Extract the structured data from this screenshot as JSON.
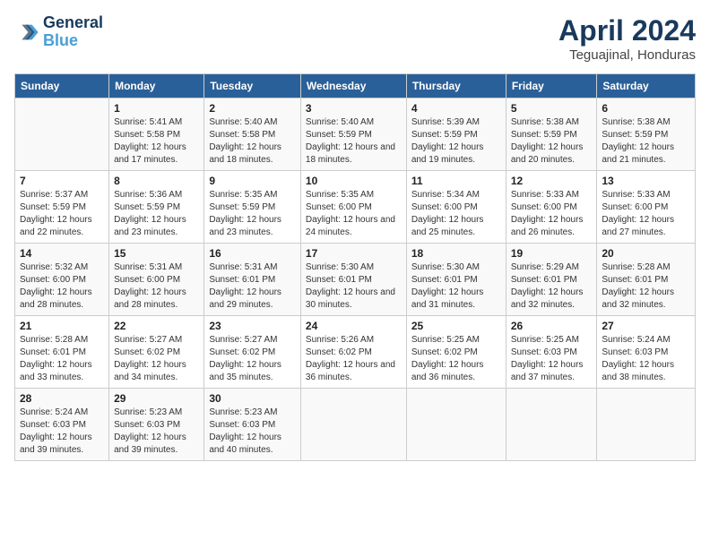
{
  "header": {
    "logo_line1": "General",
    "logo_line2": "Blue",
    "month": "April 2024",
    "location": "Teguajinal, Honduras"
  },
  "weekdays": [
    "Sunday",
    "Monday",
    "Tuesday",
    "Wednesday",
    "Thursday",
    "Friday",
    "Saturday"
  ],
  "weeks": [
    [
      {
        "day": "",
        "sunrise": "",
        "sunset": "",
        "daylight": ""
      },
      {
        "day": "1",
        "sunrise": "Sunrise: 5:41 AM",
        "sunset": "Sunset: 5:58 PM",
        "daylight": "Daylight: 12 hours and 17 minutes."
      },
      {
        "day": "2",
        "sunrise": "Sunrise: 5:40 AM",
        "sunset": "Sunset: 5:58 PM",
        "daylight": "Daylight: 12 hours and 18 minutes."
      },
      {
        "day": "3",
        "sunrise": "Sunrise: 5:40 AM",
        "sunset": "Sunset: 5:59 PM",
        "daylight": "Daylight: 12 hours and 18 minutes."
      },
      {
        "day": "4",
        "sunrise": "Sunrise: 5:39 AM",
        "sunset": "Sunset: 5:59 PM",
        "daylight": "Daylight: 12 hours and 19 minutes."
      },
      {
        "day": "5",
        "sunrise": "Sunrise: 5:38 AM",
        "sunset": "Sunset: 5:59 PM",
        "daylight": "Daylight: 12 hours and 20 minutes."
      },
      {
        "day": "6",
        "sunrise": "Sunrise: 5:38 AM",
        "sunset": "Sunset: 5:59 PM",
        "daylight": "Daylight: 12 hours and 21 minutes."
      }
    ],
    [
      {
        "day": "7",
        "sunrise": "Sunrise: 5:37 AM",
        "sunset": "Sunset: 5:59 PM",
        "daylight": "Daylight: 12 hours and 22 minutes."
      },
      {
        "day": "8",
        "sunrise": "Sunrise: 5:36 AM",
        "sunset": "Sunset: 5:59 PM",
        "daylight": "Daylight: 12 hours and 23 minutes."
      },
      {
        "day": "9",
        "sunrise": "Sunrise: 5:35 AM",
        "sunset": "Sunset: 5:59 PM",
        "daylight": "Daylight: 12 hours and 23 minutes."
      },
      {
        "day": "10",
        "sunrise": "Sunrise: 5:35 AM",
        "sunset": "Sunset: 6:00 PM",
        "daylight": "Daylight: 12 hours and 24 minutes."
      },
      {
        "day": "11",
        "sunrise": "Sunrise: 5:34 AM",
        "sunset": "Sunset: 6:00 PM",
        "daylight": "Daylight: 12 hours and 25 minutes."
      },
      {
        "day": "12",
        "sunrise": "Sunrise: 5:33 AM",
        "sunset": "Sunset: 6:00 PM",
        "daylight": "Daylight: 12 hours and 26 minutes."
      },
      {
        "day": "13",
        "sunrise": "Sunrise: 5:33 AM",
        "sunset": "Sunset: 6:00 PM",
        "daylight": "Daylight: 12 hours and 27 minutes."
      }
    ],
    [
      {
        "day": "14",
        "sunrise": "Sunrise: 5:32 AM",
        "sunset": "Sunset: 6:00 PM",
        "daylight": "Daylight: 12 hours and 28 minutes."
      },
      {
        "day": "15",
        "sunrise": "Sunrise: 5:31 AM",
        "sunset": "Sunset: 6:00 PM",
        "daylight": "Daylight: 12 hours and 28 minutes."
      },
      {
        "day": "16",
        "sunrise": "Sunrise: 5:31 AM",
        "sunset": "Sunset: 6:01 PM",
        "daylight": "Daylight: 12 hours and 29 minutes."
      },
      {
        "day": "17",
        "sunrise": "Sunrise: 5:30 AM",
        "sunset": "Sunset: 6:01 PM",
        "daylight": "Daylight: 12 hours and 30 minutes."
      },
      {
        "day": "18",
        "sunrise": "Sunrise: 5:30 AM",
        "sunset": "Sunset: 6:01 PM",
        "daylight": "Daylight: 12 hours and 31 minutes."
      },
      {
        "day": "19",
        "sunrise": "Sunrise: 5:29 AM",
        "sunset": "Sunset: 6:01 PM",
        "daylight": "Daylight: 12 hours and 32 minutes."
      },
      {
        "day": "20",
        "sunrise": "Sunrise: 5:28 AM",
        "sunset": "Sunset: 6:01 PM",
        "daylight": "Daylight: 12 hours and 32 minutes."
      }
    ],
    [
      {
        "day": "21",
        "sunrise": "Sunrise: 5:28 AM",
        "sunset": "Sunset: 6:01 PM",
        "daylight": "Daylight: 12 hours and 33 minutes."
      },
      {
        "day": "22",
        "sunrise": "Sunrise: 5:27 AM",
        "sunset": "Sunset: 6:02 PM",
        "daylight": "Daylight: 12 hours and 34 minutes."
      },
      {
        "day": "23",
        "sunrise": "Sunrise: 5:27 AM",
        "sunset": "Sunset: 6:02 PM",
        "daylight": "Daylight: 12 hours and 35 minutes."
      },
      {
        "day": "24",
        "sunrise": "Sunrise: 5:26 AM",
        "sunset": "Sunset: 6:02 PM",
        "daylight": "Daylight: 12 hours and 36 minutes."
      },
      {
        "day": "25",
        "sunrise": "Sunrise: 5:25 AM",
        "sunset": "Sunset: 6:02 PM",
        "daylight": "Daylight: 12 hours and 36 minutes."
      },
      {
        "day": "26",
        "sunrise": "Sunrise: 5:25 AM",
        "sunset": "Sunset: 6:03 PM",
        "daylight": "Daylight: 12 hours and 37 minutes."
      },
      {
        "day": "27",
        "sunrise": "Sunrise: 5:24 AM",
        "sunset": "Sunset: 6:03 PM",
        "daylight": "Daylight: 12 hours and 38 minutes."
      }
    ],
    [
      {
        "day": "28",
        "sunrise": "Sunrise: 5:24 AM",
        "sunset": "Sunset: 6:03 PM",
        "daylight": "Daylight: 12 hours and 39 minutes."
      },
      {
        "day": "29",
        "sunrise": "Sunrise: 5:23 AM",
        "sunset": "Sunset: 6:03 PM",
        "daylight": "Daylight: 12 hours and 39 minutes."
      },
      {
        "day": "30",
        "sunrise": "Sunrise: 5:23 AM",
        "sunset": "Sunset: 6:03 PM",
        "daylight": "Daylight: 12 hours and 40 minutes."
      },
      {
        "day": "",
        "sunrise": "",
        "sunset": "",
        "daylight": ""
      },
      {
        "day": "",
        "sunrise": "",
        "sunset": "",
        "daylight": ""
      },
      {
        "day": "",
        "sunrise": "",
        "sunset": "",
        "daylight": ""
      },
      {
        "day": "",
        "sunrise": "",
        "sunset": "",
        "daylight": ""
      }
    ]
  ]
}
